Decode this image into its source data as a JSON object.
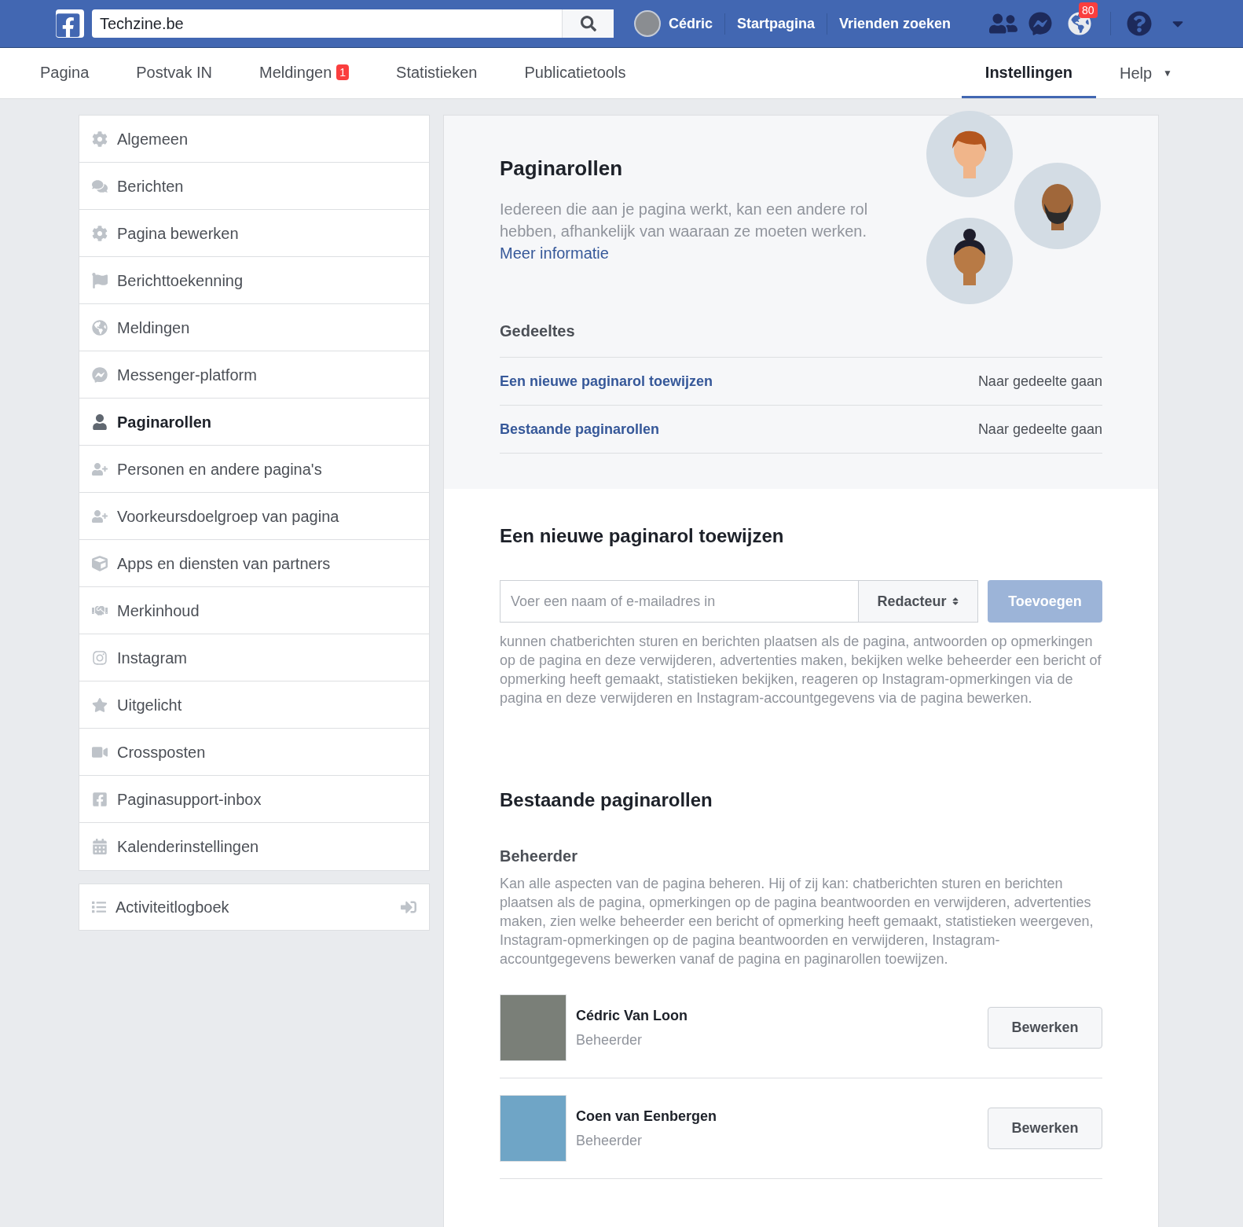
{
  "top_bar": {
    "search_value": "Techzine.be",
    "user": "Cédric",
    "links": [
      "Startpagina",
      "Vrienden zoeken"
    ],
    "notifications_badge": "80"
  },
  "page_nav": {
    "tabs": [
      {
        "label": "Pagina",
        "selected": false
      },
      {
        "label": "Postvak IN",
        "selected": false
      },
      {
        "label": "Meldingen",
        "badge": "1",
        "selected": false
      },
      {
        "label": "Statistieken",
        "selected": false
      },
      {
        "label": "Publicatietools",
        "selected": false
      },
      {
        "label": "Instellingen",
        "selected": true
      }
    ],
    "help": {
      "label": "Help",
      "caret": "▼"
    }
  },
  "sidebar": {
    "items": [
      {
        "label": "Algemeen",
        "kind": "gear",
        "selected": false
      },
      {
        "label": "Berichten",
        "kind": "comments",
        "selected": false
      },
      {
        "label": "Pagina bewerken",
        "kind": "gear",
        "selected": false
      },
      {
        "label": "Berichttoekenning",
        "kind": "flag",
        "selected": false
      },
      {
        "label": "Meldingen",
        "kind": "globe",
        "selected": false
      },
      {
        "label": "Messenger-platform",
        "kind": "messenger",
        "selected": false
      },
      {
        "label": "Paginarollen",
        "kind": "person",
        "selected": true
      },
      {
        "label": "Personen en andere pagina's",
        "kind": "people",
        "selected": false
      },
      {
        "label": "Voorkeursdoelgroep van pagina",
        "kind": "people",
        "selected": false
      },
      {
        "label": "Apps en diensten van partners",
        "kind": "apps",
        "selected": false
      },
      {
        "label": "Merkinhoud",
        "kind": "brand",
        "selected": false
      },
      {
        "label": "Instagram",
        "kind": "instagram",
        "selected": false
      },
      {
        "label": "Uitgelicht",
        "kind": "featured",
        "selected": false
      },
      {
        "label": "Crossposten",
        "kind": "video",
        "selected": false
      },
      {
        "label": "Paginasupport-inbox",
        "kind": "support",
        "selected": false
      },
      {
        "label": "Kalenderinstellingen",
        "kind": "calendar",
        "selected": false
      }
    ],
    "footer": {
      "label": "Activiteitlogboek"
    }
  },
  "intro": {
    "title": "Paginarollen",
    "description": "Iedereen die aan je pagina werkt, kan een andere rol hebben, afhankelijk van waaraan ze moeten werken.",
    "link": "Meer informatie"
  },
  "sections": {
    "title": "Gedeeltes",
    "rows": [
      {
        "label": "Een nieuwe paginarol toewijzen",
        "action": "Naar gedeelte gaan"
      },
      {
        "label": "Bestaande paginarollen",
        "action": "Naar gedeelte gaan"
      }
    ]
  },
  "assign": {
    "title": "Een nieuwe paginarol toewijzen",
    "placeholder": "Voer een naam of e-mailadres in",
    "role": "Redacteur",
    "button": "Toevoegen",
    "button_disabled": true,
    "description": "kunnen chatberichten sturen en berichten plaatsen als de pagina, antwoorden op opmerkingen op de pagina en deze verwijderen, advertenties maken, bekijken welke beheerder een bericht of opmerking heeft gemaakt, statistieken bekijken, reageren op Instagram-opmerkingen via de pagina en deze verwijderen en Instagram-accountgegevens via de pagina bewerken."
  },
  "existing": {
    "title": "Bestaande paginarollen",
    "group_title": "Beheerder",
    "group_description": "Kan alle aspecten van de pagina beheren. Hij of zij kan: chatberichten sturen en berichten plaatsen als de pagina, opmerkingen op de pagina beantwoorden en verwijderen, advertenties maken, zien welke beheerder een bericht of opmerking heeft gemaakt, statistieken weergeven, Instagram-opmerkingen op de pagina beantwoorden en verwijderen, Instagram-accountgegevens bewerken vanaf de pagina en paginarollen toewijzen.",
    "people": [
      {
        "name": "Cédric Van Loon",
        "role": "Beheerder",
        "button": "Bewerken"
      },
      {
        "name": "Coen van Eenbergen",
        "role": "Beheerder",
        "button": "Bewerken"
      }
    ]
  }
}
